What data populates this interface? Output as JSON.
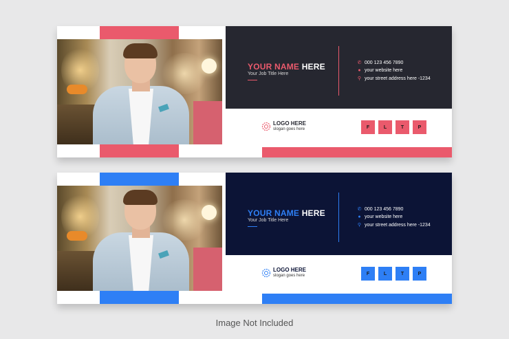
{
  "cards": [
    {
      "accent": "#ea5a6c",
      "dark_bg": "#262730",
      "name_highlight": "YOUR NAME",
      "name_rest": "HERE",
      "job_title": "Your Job Title Here",
      "contacts": [
        {
          "icon": "phone-icon",
          "text": "000 123 456 7890"
        },
        {
          "icon": "globe-icon",
          "text": "your website here"
        },
        {
          "icon": "location-pin-icon",
          "text": "your street address here -1234"
        }
      ],
      "logo_title": "LOGO HERE",
      "logo_slogan": "slogan goes here",
      "social": [
        "F",
        "L",
        "T",
        "P"
      ]
    },
    {
      "accent": "#2e7ff5",
      "dark_bg": "#0c1436",
      "name_highlight": "YOUR NAME",
      "name_rest": "HERE",
      "job_title": "Your Job Title Here",
      "contacts": [
        {
          "icon": "phone-icon",
          "text": "000 123 456 7890"
        },
        {
          "icon": "globe-icon",
          "text": "your website here"
        },
        {
          "icon": "location-pin-icon",
          "text": "your street address here -1234"
        }
      ],
      "logo_title": "LOGO HERE",
      "logo_slogan": "slogan goes here",
      "social": [
        "F",
        "L",
        "T",
        "P"
      ]
    }
  ],
  "footer": "Image Not Included"
}
